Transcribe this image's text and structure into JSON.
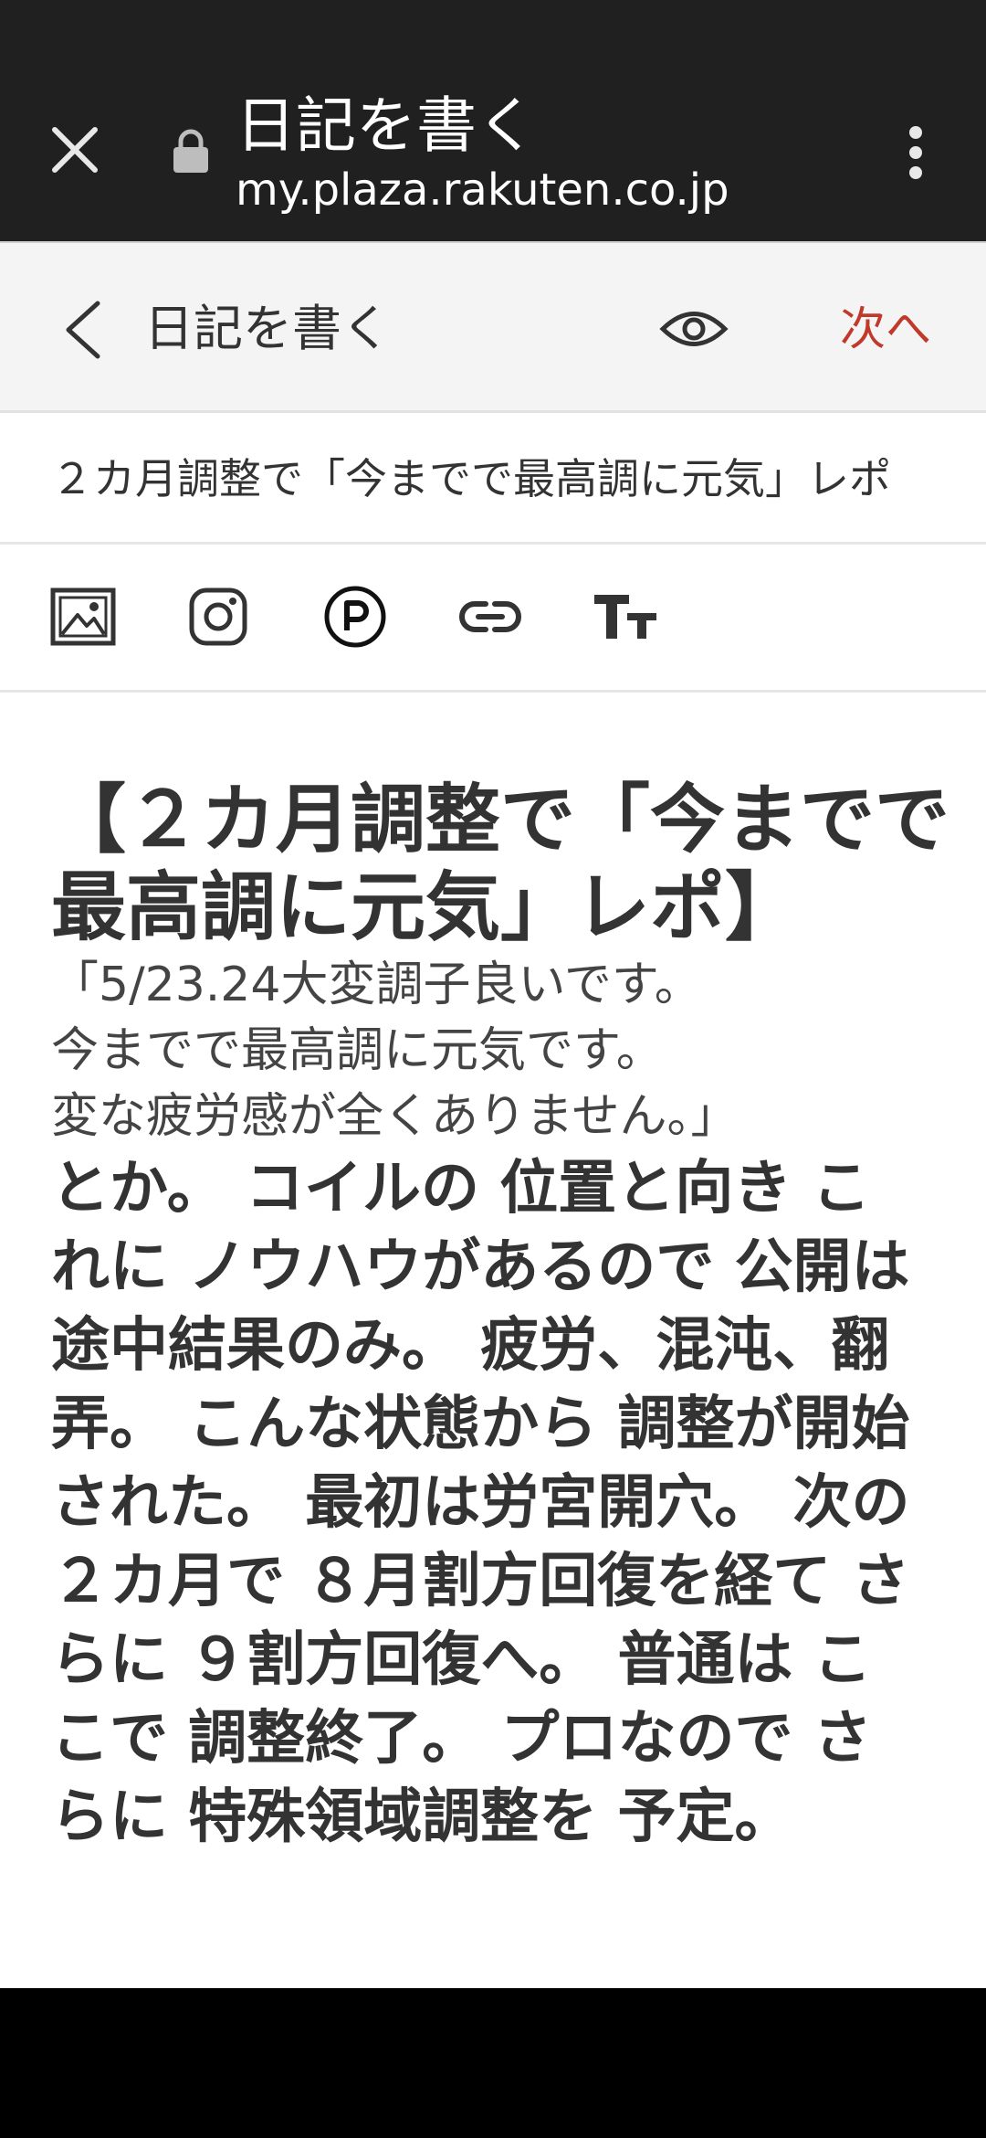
{
  "browser": {
    "title": "日記を書く",
    "url": "my.plaza.rakuten.co.jp"
  },
  "header": {
    "title": "日記を書く",
    "next_label": "次へ"
  },
  "post": {
    "title": "２カ月調整で「今までで最高調に元気」レポ"
  },
  "editor": {
    "heading_lines": [
      "【２カ月調整で「今までで",
      "最高調に元気」レポ】"
    ],
    "quote_lines": [
      "「5/23.24大変調子良いです。",
      "今までで最高調に元気です。",
      "変な疲労感が全くありません。」"
    ],
    "body_lines": [
      "とか。 コイルの 位置と向き こ",
      "れに ノウハウがあるので 公開は",
      "途中結果のみ。 疲労、混沌、翻",
      "弄。 こんな状態から 調整が開始",
      "された。 最初は労宮開穴。 次の",
      "２カ月で ８月割方回復を経て さ",
      "らに ９割方回復へ。 普通は こ",
      "こで 調整終了。 プロなので さ",
      "らに 特殊領域調整を 予定。"
    ]
  },
  "colors": {
    "browser_bar": "#202020",
    "header_bg": "#f4f4f4",
    "accent_red": "#c0392b",
    "text": "#333333"
  },
  "icons": {
    "close": "close-icon",
    "lock": "lock-icon",
    "menu": "more-vert-icon",
    "back": "chevron-left-icon",
    "preview": "eye-icon",
    "image": "image-icon",
    "instagram": "instagram-icon",
    "point": "p-circle-icon",
    "link": "link-icon",
    "text_size": "text-size-icon"
  }
}
